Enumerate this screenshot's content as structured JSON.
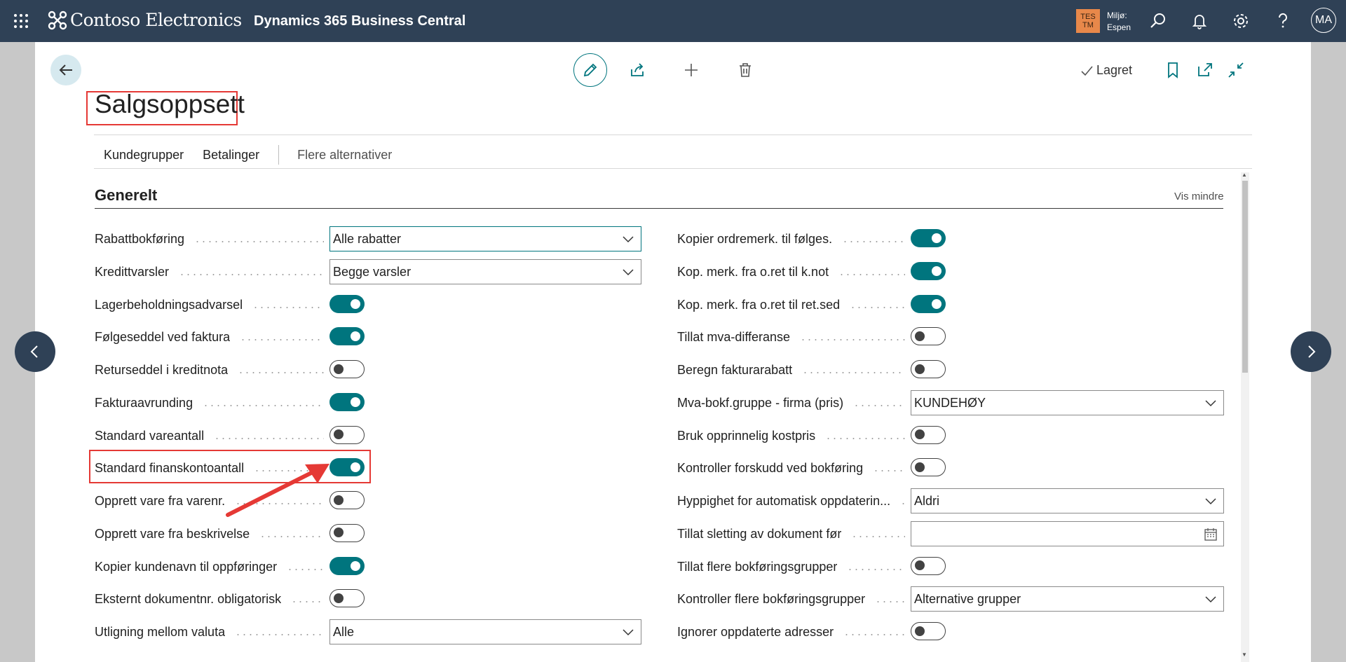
{
  "topbar": {
    "company": "Contoso Electronics",
    "product": "Dynamics 365 Business Central",
    "env_badge_line1": "TES",
    "env_badge_line2": "TM",
    "env_label": "Miljø:",
    "env_name": "Espen",
    "avatar_initials": "MA"
  },
  "header": {
    "saved_label": "Lagret",
    "page_title": "Salgsoppsett"
  },
  "actionbar": {
    "items": [
      "Kundegrupper",
      "Betalinger"
    ],
    "more": "Flere alternativer"
  },
  "section": {
    "title": "Generelt",
    "collapse_label": "Vis mindre"
  },
  "left_fields": [
    {
      "label": "Rabattbokføring",
      "type": "select",
      "value": "Alle rabatter"
    },
    {
      "label": "Kredittvarsler",
      "type": "select",
      "value": "Begge varsler"
    },
    {
      "label": "Lagerbeholdningsadvarsel",
      "type": "toggle",
      "on": true
    },
    {
      "label": "Følgeseddel ved faktura",
      "type": "toggle",
      "on": true
    },
    {
      "label": "Returseddel i kreditnota",
      "type": "toggle",
      "on": false
    },
    {
      "label": "Fakturaavrunding",
      "type": "toggle",
      "on": true
    },
    {
      "label": "Standard vareantall",
      "type": "toggle",
      "on": false
    },
    {
      "label": "Standard finanskontoantall",
      "type": "toggle",
      "on": true
    },
    {
      "label": "Opprett vare fra varenr.",
      "type": "toggle",
      "on": false
    },
    {
      "label": "Opprett vare fra beskrivelse",
      "type": "toggle",
      "on": false
    },
    {
      "label": "Kopier kundenavn til oppføringer",
      "type": "toggle",
      "on": true
    },
    {
      "label": "Eksternt dokumentnr. obligatorisk",
      "type": "toggle",
      "on": false
    },
    {
      "label": "Utligning mellom valuta",
      "type": "select",
      "value": "Alle"
    }
  ],
  "right_fields": [
    {
      "label": "Kopier ordremerk. til følges.",
      "type": "toggle",
      "on": true
    },
    {
      "label": "Kop. merk. fra o.ret til k.not",
      "type": "toggle",
      "on": true
    },
    {
      "label": "Kop. merk. fra o.ret til ret.sed",
      "type": "toggle",
      "on": true
    },
    {
      "label": "Tillat mva-differanse",
      "type": "toggle",
      "on": false
    },
    {
      "label": "Beregn fakturarabatt",
      "type": "toggle",
      "on": false
    },
    {
      "label": "Mva-bokf.gruppe - firma (pris)",
      "type": "select",
      "value": "KUNDEHØY"
    },
    {
      "label": "Bruk opprinnelig kostpris",
      "type": "toggle",
      "on": false
    },
    {
      "label": "Kontroller forskudd ved bokføring",
      "type": "toggle",
      "on": false
    },
    {
      "label": "Hyppighet for automatisk oppdaterin...",
      "type": "select",
      "value": "Aldri"
    },
    {
      "label": "Tillat sletting av dokument før",
      "type": "date",
      "value": ""
    },
    {
      "label": "Tillat flere bokføringsgrupper",
      "type": "toggle",
      "on": false
    },
    {
      "label": "Kontroller flere bokføringsgrupper",
      "type": "select",
      "value": "Alternative grupper"
    },
    {
      "label": "Ignorer oppdaterte adresser",
      "type": "toggle",
      "on": false
    }
  ]
}
